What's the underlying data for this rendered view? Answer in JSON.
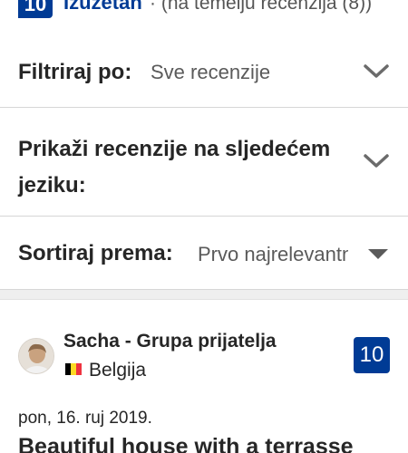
{
  "summary": {
    "score": "10",
    "rating_word": "Izuzetan",
    "basis": "· (na temelju recenzija (8))"
  },
  "filters": {
    "filter_label": "Filtriraj po:",
    "filter_value": "Sve recenzije",
    "language_label": "Prikaži recenzije na sljedećem jeziku:",
    "sort_label": "Sortiraj prema:",
    "sort_value": "Prvo najrelevantnije"
  },
  "icons": {
    "filter_chevron": "chevron-down-icon",
    "language_chevron": "chevron-down-icon",
    "sort_caret": "caret-down-icon"
  },
  "review": {
    "reviewer": "Sacha - Grupa prijatelja",
    "country": "Belgija",
    "country_flag": "belgium-flag-icon",
    "score": "10",
    "date": "pon, 16. ruj 2019.",
    "title": "Beautiful house with a terrasse"
  },
  "colors": {
    "brand_blue": "#003b95",
    "flag": [
      "#000000",
      "#fdda24",
      "#ef3340"
    ]
  }
}
